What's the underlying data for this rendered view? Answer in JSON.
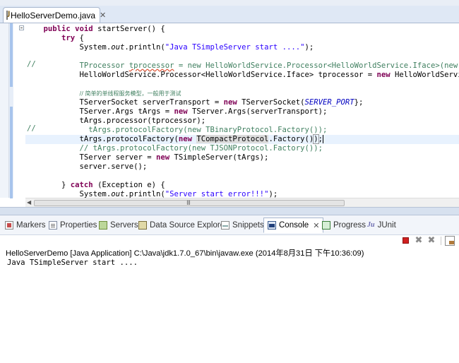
{
  "editor": {
    "tab_title": "HelloServerDemo.java",
    "tab_close": "✕",
    "lines": [
      {
        "indent": "    ",
        "parts": [
          [
            "kw",
            "public void "
          ],
          [
            "",
            "startServer() {"
          ]
        ]
      },
      {
        "indent": "        ",
        "parts": [
          [
            "kw",
            "try"
          ],
          [
            "",
            " {"
          ]
        ]
      },
      {
        "indent": "            ",
        "parts": [
          [
            "",
            "System."
          ],
          [
            "italic",
            "out"
          ],
          [
            "",
            ".println("
          ],
          [
            "str",
            "\"Java TSimpleServer start ....\""
          ],
          [
            "",
            ");"
          ]
        ]
      },
      {
        "indent": "",
        "parts": []
      },
      {
        "indent": "            ",
        "parts": [
          [
            "comment",
            "TProcessor "
          ],
          [
            "comment underline",
            "tprocessor"
          ],
          [
            "comment",
            " = new HelloWorldService.Processor<HelloWorldService.Iface>(new  HelloWo"
          ]
        ]
      },
      {
        "indent": "            ",
        "parts": [
          [
            "",
            "HelloWorldService.Processor<HelloWorldService.Iface> tprocessor = "
          ],
          [
            "kw",
            "new "
          ],
          [
            "",
            "HelloWorldService.Proc"
          ]
        ]
      },
      {
        "indent": "",
        "parts": []
      },
      {
        "indent": "            ",
        "parts": [
          [
            "cn-comment",
            "// 简单的单线程服务模型，一般用于测试"
          ]
        ]
      },
      {
        "indent": "            ",
        "parts": [
          [
            "",
            "TServerSocket serverTransport = "
          ],
          [
            "kw",
            "new "
          ],
          [
            "",
            "TServerSocket("
          ],
          [
            "const",
            "SERVER_PORT"
          ],
          [
            "",
            "};"
          ]
        ]
      },
      {
        "indent": "            ",
        "parts": [
          [
            "",
            "TServer.Args tArgs = "
          ],
          [
            "kw",
            "new "
          ],
          [
            "",
            "TServer.Args(serverTransport);"
          ]
        ]
      },
      {
        "indent": "            ",
        "parts": [
          [
            "",
            "tArgs.processor(tprocessor);"
          ]
        ]
      },
      {
        "indent": "            ",
        "parts": [
          [
            "comment",
            "  tArgs.protocolFactory(new TBinaryProtocol.Factory());"
          ]
        ]
      },
      {
        "indent": "            ",
        "parts": [
          [
            "",
            "tArgs.protocolFactory("
          ],
          [
            "kw",
            "new "
          ],
          [
            "selword",
            "TCompactProtocol"
          ],
          [
            "",
            ".Factory()"
          ],
          [
            "bracket-box",
            ")"
          ],
          [
            "",
            ";"
          ]
        ]
      },
      {
        "indent": "            ",
        "parts": [
          [
            "comment",
            "// tArgs.protocolFactory(new TJSONProtocol.Factory());"
          ]
        ]
      },
      {
        "indent": "            ",
        "parts": [
          [
            "",
            "TServer server = "
          ],
          [
            "kw",
            "new "
          ],
          [
            "",
            "TSimpleServer(tArgs);"
          ]
        ]
      },
      {
        "indent": "            ",
        "parts": [
          [
            "",
            "server.serve();"
          ]
        ]
      },
      {
        "indent": "",
        "parts": []
      },
      {
        "indent": "        ",
        "parts": [
          [
            "",
            "} "
          ],
          [
            "kw",
            "catch"
          ],
          [
            "",
            " (Exception e) {"
          ]
        ]
      },
      {
        "indent": "            ",
        "parts": [
          [
            "",
            "System."
          ],
          [
            "italic",
            "out"
          ],
          [
            "",
            ".println("
          ],
          [
            "str",
            "\"Server start error!!!\""
          ],
          [
            "",
            ");"
          ]
        ]
      }
    ],
    "line_comment_marker": "//",
    "scroll_grip": "III"
  },
  "views": {
    "tabs": [
      {
        "label": "Markers",
        "icon": "markers-icon"
      },
      {
        "label": "Properties",
        "icon": "properties-icon"
      },
      {
        "label": "Servers",
        "icon": "servers-icon"
      },
      {
        "label": "Data Source Explorer",
        "icon": "data-source-explorer-icon"
      },
      {
        "label": "Snippets",
        "icon": "snippets-icon"
      },
      {
        "label": "Console",
        "icon": "console-icon"
      },
      {
        "label": "Progress",
        "icon": "progress-icon"
      },
      {
        "label": "JUnit",
        "icon": "junit-icon"
      }
    ],
    "active_tab": "Console",
    "console_tab_close": "✕"
  },
  "console": {
    "header": "HelloServerDemo [Java Application] C:\\Java\\jdk1.7.0_67\\bin\\javaw.exe (2014年8月31日 下午10:36:09)",
    "output": "Java TSimpleServer start ....",
    "toolbar": {
      "remove": "✖",
      "remove_all": "✖"
    }
  },
  "colors": {
    "keyword": "#7f0055",
    "string": "#2a00ff",
    "comment": "#3f7f5f",
    "constant": "#0000c0"
  }
}
